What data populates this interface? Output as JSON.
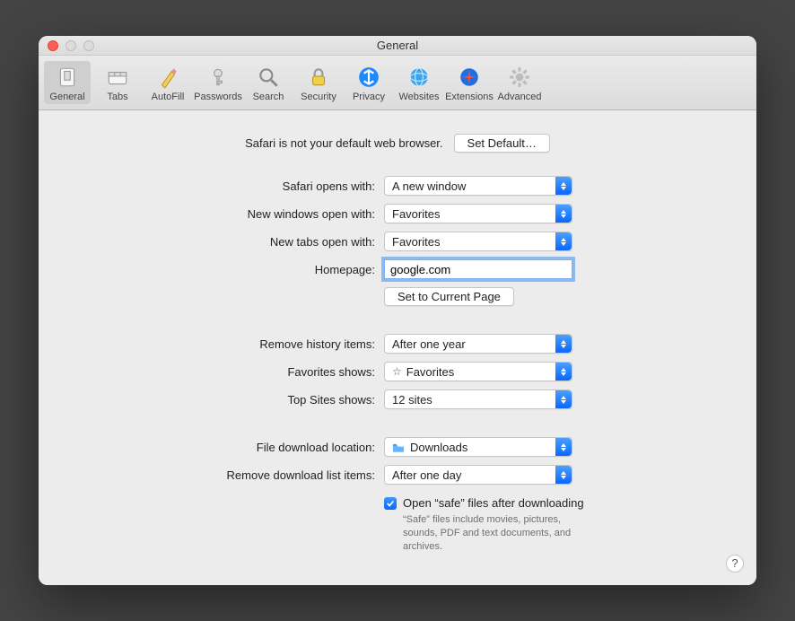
{
  "window": {
    "title": "General"
  },
  "toolbar": {
    "items": [
      {
        "label": "General",
        "selected": true
      },
      {
        "label": "Tabs",
        "selected": false
      },
      {
        "label": "AutoFill",
        "selected": false
      },
      {
        "label": "Passwords",
        "selected": false
      },
      {
        "label": "Search",
        "selected": false
      },
      {
        "label": "Security",
        "selected": false
      },
      {
        "label": "Privacy",
        "selected": false
      },
      {
        "label": "Websites",
        "selected": false
      },
      {
        "label": "Extensions",
        "selected": false
      },
      {
        "label": "Advanced",
        "selected": false
      }
    ]
  },
  "default_browser": {
    "message": "Safari is not your default web browser.",
    "button": "Set Default…"
  },
  "labels": {
    "opens_with": "Safari opens with:",
    "new_windows": "New windows open with:",
    "new_tabs": "New tabs open with:",
    "homepage": "Homepage:",
    "set_current": "Set to Current Page",
    "remove_history": "Remove history items:",
    "favorites_shows": "Favorites shows:",
    "top_sites": "Top Sites shows:",
    "download_location": "File download location:",
    "remove_downloads": "Remove download list items:"
  },
  "values": {
    "opens_with": "A new window",
    "new_windows": "Favorites",
    "new_tabs": "Favorites",
    "homepage": "google.com",
    "remove_history": "After one year",
    "favorites_shows": "Favorites",
    "top_sites": "12 sites",
    "download_location": "Downloads",
    "remove_downloads": "After one day"
  },
  "safe_files": {
    "checked": true,
    "label": "Open “safe” files after downloading",
    "sub": "“Safe” files include movies, pictures, sounds, PDF and text documents, and archives."
  },
  "help": "?"
}
